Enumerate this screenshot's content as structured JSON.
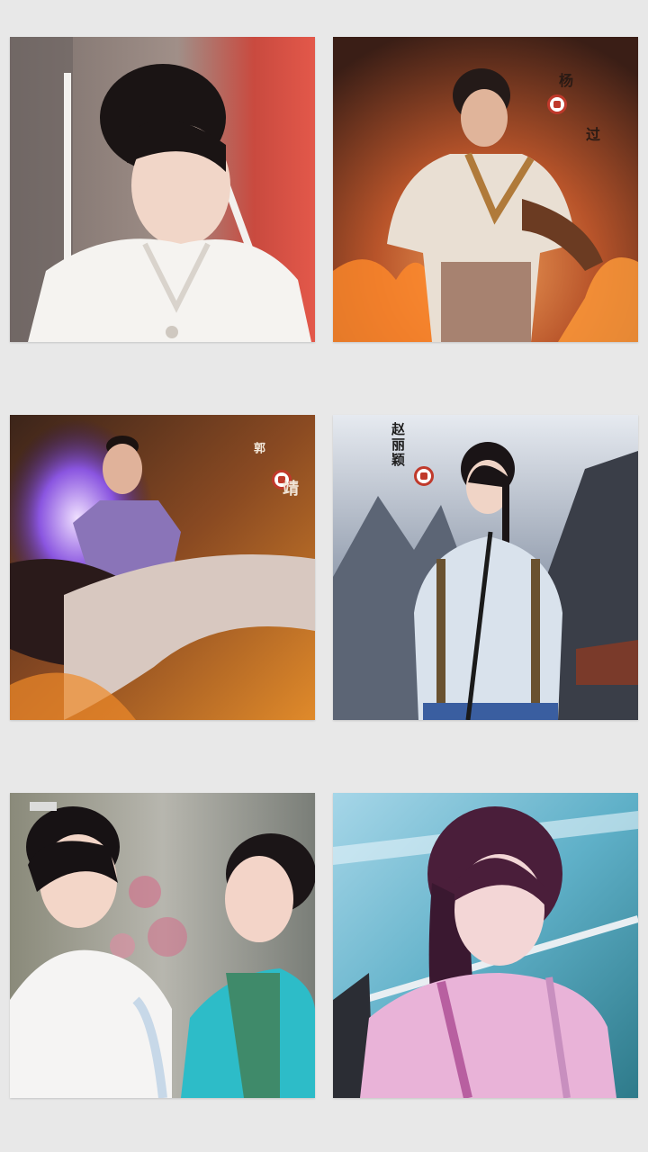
{
  "gallery": {
    "background": "#e8e8e8",
    "tiles": [
      {
        "name": "photo-woman-white-robe"
      },
      {
        "name": "photo-man-fire-poster",
        "caption_text": "杨过"
      },
      {
        "name": "photo-man-purple-flame-poster",
        "caption_text": "郭靖"
      },
      {
        "name": "photo-woman-mountain-poster",
        "caption_text": "赵丽颖"
      },
      {
        "name": "photo-two-women"
      },
      {
        "name": "photo-woman-pink-robe"
      }
    ]
  }
}
